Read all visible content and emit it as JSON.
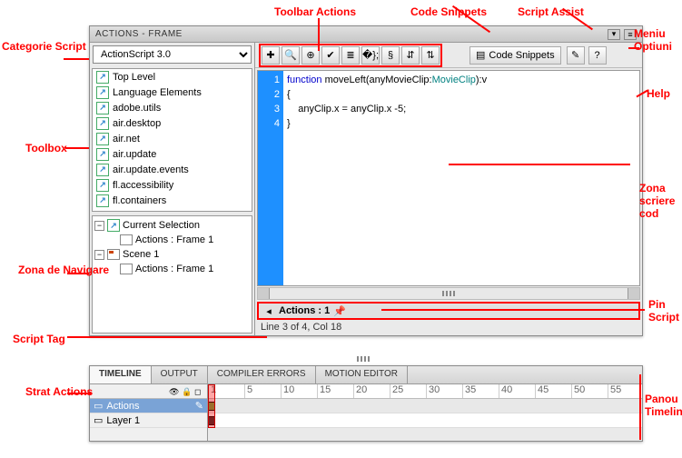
{
  "annotations": {
    "toolbar_actions": "Toolbar Actions",
    "code_snippets": "Code Snippets",
    "script_assist": "Script Assist",
    "meniu_optiuni": "Meniu Optiuni",
    "categorie_script": "Categorie Script",
    "toolbox": "Toolbox",
    "zona_navigare": "Zona de Navigare",
    "script_tag": "Script Tag",
    "help": "Help",
    "zona_scriere": "Zona scriere cod",
    "pin_script": "Pin Script",
    "strat_actions": "Strat Actions",
    "panou_timeline": "Panou Timeline"
  },
  "panel": {
    "title": "ACTIONS - FRAME"
  },
  "category": {
    "selected": "ActionScript 3.0"
  },
  "toolbox_items": [
    "Top Level",
    "Language Elements",
    "adobe.utils",
    "air.desktop",
    "air.net",
    "air.update",
    "air.update.events",
    "fl.accessibility",
    "fl.containers"
  ],
  "nav": {
    "current_selection": "Current Selection",
    "actions_frame_1a": "Actions : Frame 1",
    "scene_1": "Scene 1",
    "actions_frame_1b": "Actions : Frame 1"
  },
  "toolbar": {
    "code_snippets_label": "Code Snippets",
    "icons": [
      "add",
      "find",
      "target",
      "check",
      "format",
      "wrap",
      "collapse",
      "expand",
      "debug"
    ]
  },
  "editor": {
    "lines": [
      "1",
      "2",
      "3",
      "4"
    ],
    "fn_kw": "function",
    "fn_name": " moveLeft(anyMovieClip:",
    "type": "MovieClip",
    "fn_tail": "):v",
    "line2": "{",
    "line3": "    anyClip.x = anyClip.x -5;",
    "line4": "}"
  },
  "script_tab": {
    "label": "Actions : 1"
  },
  "status": "Line 3 of 4, Col 18",
  "timeline": {
    "tabs": [
      "TIMELINE",
      "OUTPUT",
      "COMPILER ERRORS",
      "MOTION EDITOR"
    ],
    "ruler": [
      "1",
      "5",
      "10",
      "15",
      "20",
      "25",
      "30",
      "35",
      "40",
      "45",
      "50",
      "55"
    ],
    "layers": [
      {
        "name": "Actions",
        "selected": true
      },
      {
        "name": "Layer 1",
        "selected": false
      }
    ]
  }
}
